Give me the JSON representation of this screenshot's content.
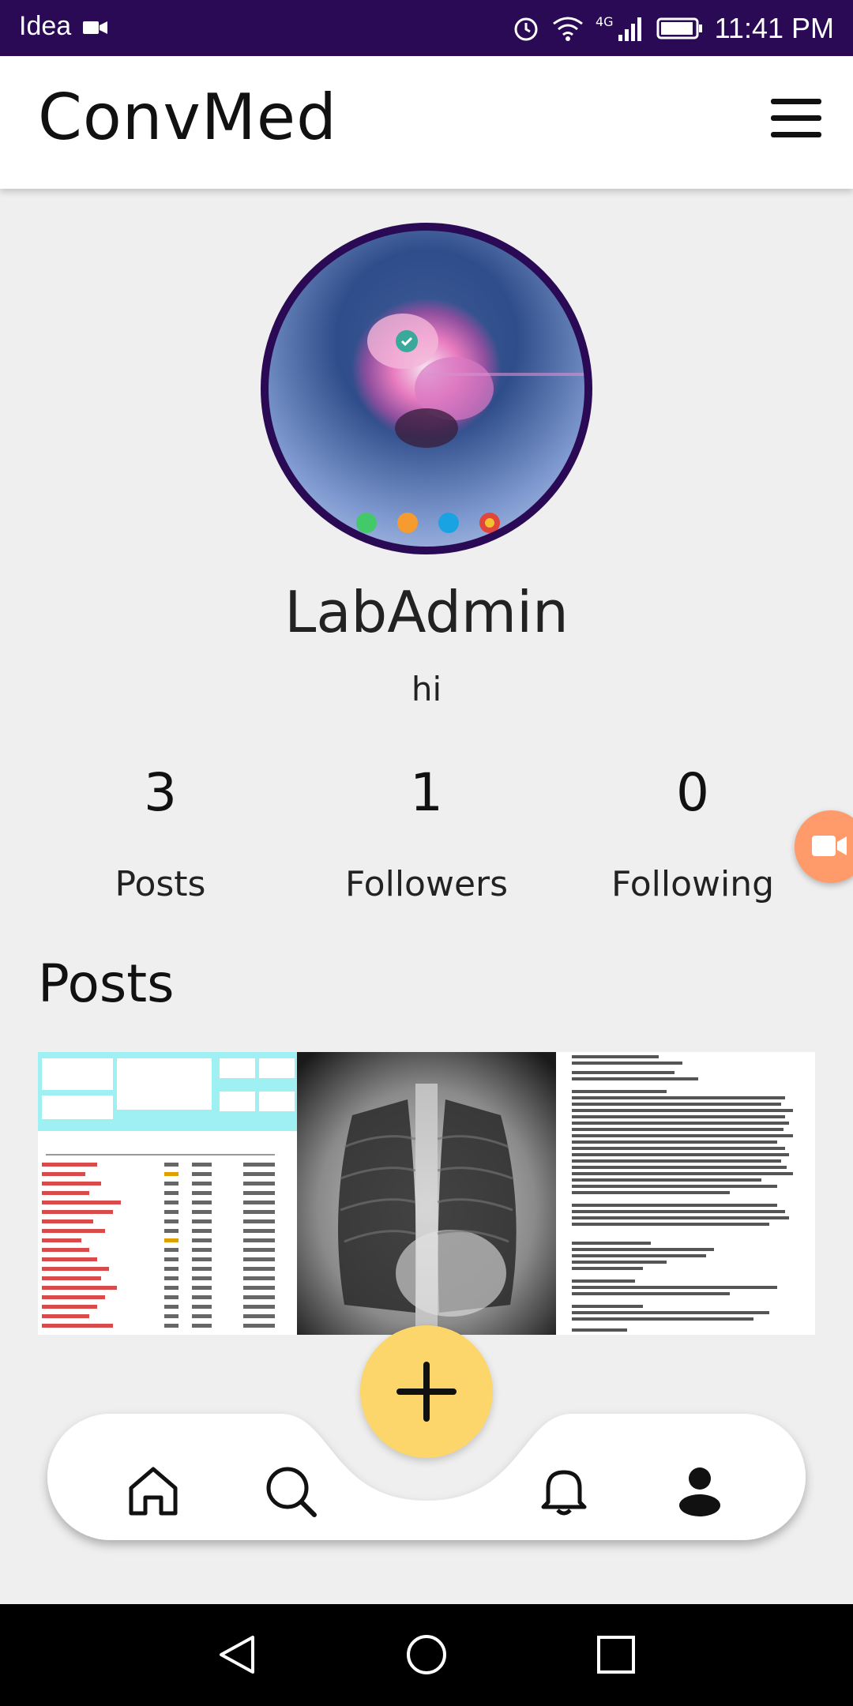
{
  "status_bar": {
    "carrier": "Idea",
    "time": "11:41 PM",
    "network": "4G"
  },
  "header": {
    "app_title": "ConvMed"
  },
  "profile": {
    "name": "LabAdmin",
    "bio": "hi",
    "stats": [
      {
        "value": "3",
        "label": "Posts"
      },
      {
        "value": "1",
        "label": "Followers"
      },
      {
        "value": "0",
        "label": "Following"
      }
    ]
  },
  "posts_section": {
    "heading": "Posts"
  },
  "colors": {
    "status_bar": "#2b0a55",
    "accent_fab": "#fcd66a",
    "video_fab": "#ff9a6b",
    "avatar_border": "#2b0a55"
  },
  "bottom_nav": {
    "items": [
      "home-icon",
      "search-icon",
      "add-icon",
      "bell-icon",
      "profile-icon"
    ]
  }
}
